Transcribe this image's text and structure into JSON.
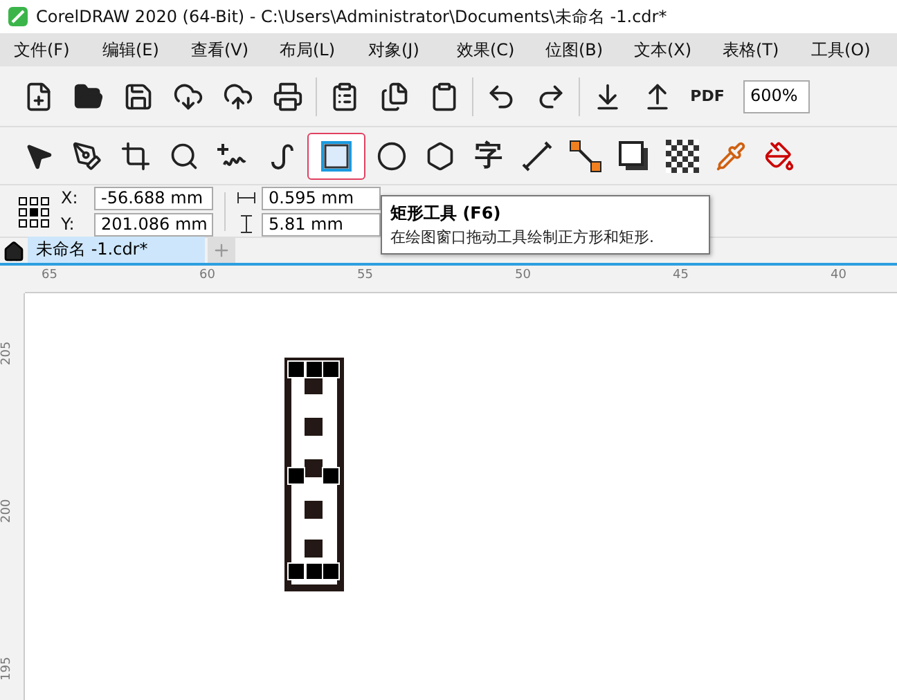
{
  "window": {
    "title": "CorelDRAW 2020 (64-Bit) - C:\\Users\\Administrator\\Documents\\未命名 -1.cdr*"
  },
  "menu": [
    "文件(F)",
    "编辑(E)",
    "查看(V)",
    "布局(L)",
    "对象(J)",
    "效果(C)",
    "位图(B)",
    "文本(X)",
    "表格(T)",
    "工具(O)"
  ],
  "standard_toolbar": {
    "buttons": [
      {
        "kind": "new"
      },
      {
        "kind": "open"
      },
      {
        "kind": "save"
      },
      {
        "kind": "cloud-down"
      },
      {
        "kind": "cloud-up"
      },
      {
        "kind": "print"
      },
      {
        "kind": "sep"
      },
      {
        "kind": "cut"
      },
      {
        "kind": "copy"
      },
      {
        "kind": "paste"
      },
      {
        "kind": "sep"
      },
      {
        "kind": "undo"
      },
      {
        "kind": "redo"
      },
      {
        "kind": "sep"
      },
      {
        "kind": "import"
      },
      {
        "kind": "export"
      },
      {
        "kind": "pdf",
        "label": "PDF"
      }
    ],
    "zoom": "600%"
  },
  "toolbox": [
    {
      "kind": "pick",
      "selected": false
    },
    {
      "kind": "shape",
      "selected": false
    },
    {
      "kind": "crop",
      "selected": false
    },
    {
      "kind": "zoom",
      "selected": false
    },
    {
      "kind": "freehand",
      "selected": false
    },
    {
      "kind": "artistic",
      "selected": false
    },
    {
      "kind": "rectangle",
      "selected": true
    },
    {
      "kind": "ellipse",
      "selected": false
    },
    {
      "kind": "polygon",
      "selected": false
    },
    {
      "kind": "text",
      "label": "字",
      "selected": false
    },
    {
      "kind": "dimension",
      "selected": false
    },
    {
      "kind": "connector",
      "selected": false
    },
    {
      "kind": "shadow",
      "selected": false
    },
    {
      "kind": "transparency",
      "selected": false
    },
    {
      "kind": "eyedropper",
      "selected": false
    },
    {
      "kind": "fill",
      "selected": false
    }
  ],
  "property_bar": {
    "x_label": "X:",
    "x": "-56.688 mm",
    "y_label": "Y:",
    "y": "201.086 mm",
    "width": "0.595 mm",
    "height": "5.81 mm"
  },
  "tooltip": {
    "title": "矩形工具",
    "shortcut": "(F6)",
    "text": "在绘图窗口拖动工具绘制正方形和矩形."
  },
  "document_tabs": [
    {
      "label": "未命名 -1.cdr*",
      "selected": true
    }
  ],
  "ruler": {
    "horizontal": [
      "65",
      "60",
      "55",
      "50",
      "45",
      "40"
    ],
    "vertical": [
      "205",
      "200",
      "195"
    ]
  }
}
